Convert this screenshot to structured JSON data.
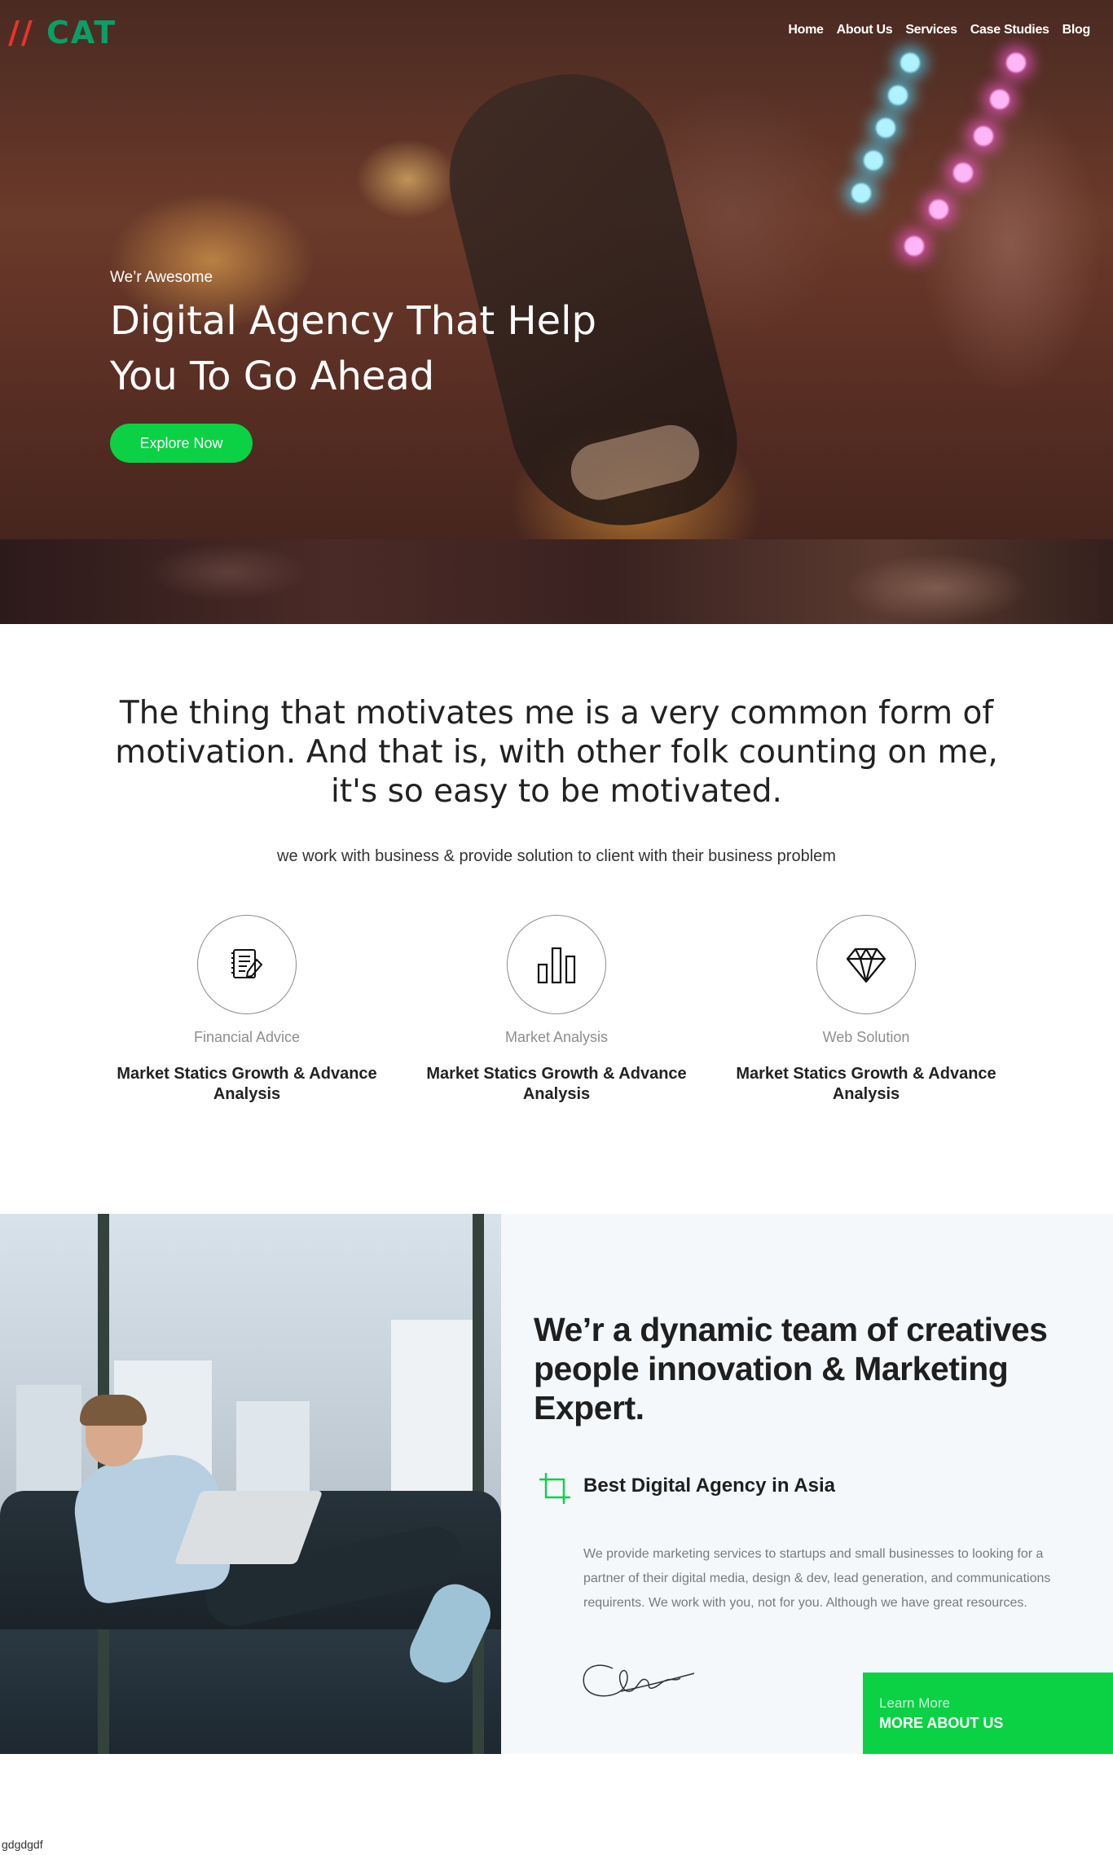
{
  "brand": {
    "slash": "//",
    "name": "CAT"
  },
  "nav": {
    "items": [
      {
        "label": "Home"
      },
      {
        "label": "About Us"
      },
      {
        "label": "Services"
      },
      {
        "label": "Case Studies"
      },
      {
        "label": "Blog"
      }
    ]
  },
  "hero": {
    "kicker": "We’r Awesome",
    "title_line1": "Digital Agency That Help",
    "title_line2": "You To Go Ahead",
    "button_label": "Explore Now"
  },
  "motivation": {
    "quote": "The thing that motivates me is a very common form of motivation. And that is, with other folk counting on me, it's so easy to be motivated.",
    "subline": "we work with business & provide solution to client with their business problem"
  },
  "features": [
    {
      "icon": "notebook-icon",
      "label": "Financial Advice",
      "title": "Market Statics Growth & Advance Analysis"
    },
    {
      "icon": "bar-chart-icon",
      "label": "Market Analysis",
      "title": "Market Statics Growth & Advance Analysis"
    },
    {
      "icon": "diamond-icon",
      "label": "Web Solution",
      "title": "Market Statics Growth & Advance Analysis"
    }
  ],
  "about": {
    "heading": "We’r a dynamic team of creatives people innovation & Marketing Expert.",
    "subheading": "Best Digital Agency in Asia",
    "text": "We provide marketing services to startups and small businesses to looking for a partner of their digital media, design & dev, lead generation, and communications requirents. We work with you, not for you. Although we have great resources.",
    "cta_small": "Learn More",
    "cta_big": "MORE ABOUT US"
  },
  "footer": {
    "note": "gdgdgdf"
  },
  "colors": {
    "accent": "#0bd145",
    "logo_slash": "#e8332e",
    "logo_name": "#0a9f66",
    "panel_bg": "#f4f8fb"
  }
}
